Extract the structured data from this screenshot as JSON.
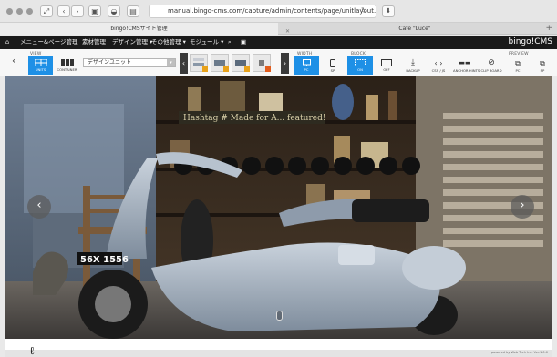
{
  "browser": {
    "url": "manual.bingo-cms.com/capture/admin/contents/page/unitlayout.php?pidx_con",
    "tabs": [
      {
        "label": "bingo!CMSサイト管理",
        "active": true
      },
      {
        "label": "Cafe \"Luce\"",
        "active": false
      }
    ]
  },
  "header": {
    "nav": [
      "メニュー&ページ管理",
      "素材管理",
      "デザイン管理 ▾",
      "その他管理 ▾",
      "モジュール ▾"
    ],
    "brand": "bingo!CMS"
  },
  "toolbar": {
    "groups": {
      "view": "VIEW",
      "width": "WIDTH",
      "block": "BLOCK",
      "preview": "PREVIEW"
    },
    "layout_buttons": [
      {
        "label": "UNITS",
        "active": true
      },
      {
        "label": "CONTAINER",
        "active": false
      }
    ],
    "design_unit": "デザインユニット",
    "view_buttons": [
      {
        "label": "PC",
        "active": true
      },
      {
        "label": "SP",
        "active": false
      }
    ],
    "block_buttons": [
      {
        "label": "ON",
        "active": true
      },
      {
        "label": "OFF",
        "active": false
      }
    ],
    "action_buttons": [
      "BACKUP",
      "CSS / JS",
      "ANCHOR HINTS",
      "CLIP BOARD"
    ],
    "preview_buttons": [
      "PC",
      "SP"
    ]
  },
  "photo": {
    "sign_text": "Hashtag # Made for A... featured!",
    "plate": "56X 1556"
  },
  "footer": {
    "powered": "powered by Web Tech Inc. Ver.1.0.0"
  },
  "colors": {
    "header_bg": "#1a1a1a",
    "accent_blue": "#1e90e6",
    "scooter": "#9aa8b8"
  }
}
